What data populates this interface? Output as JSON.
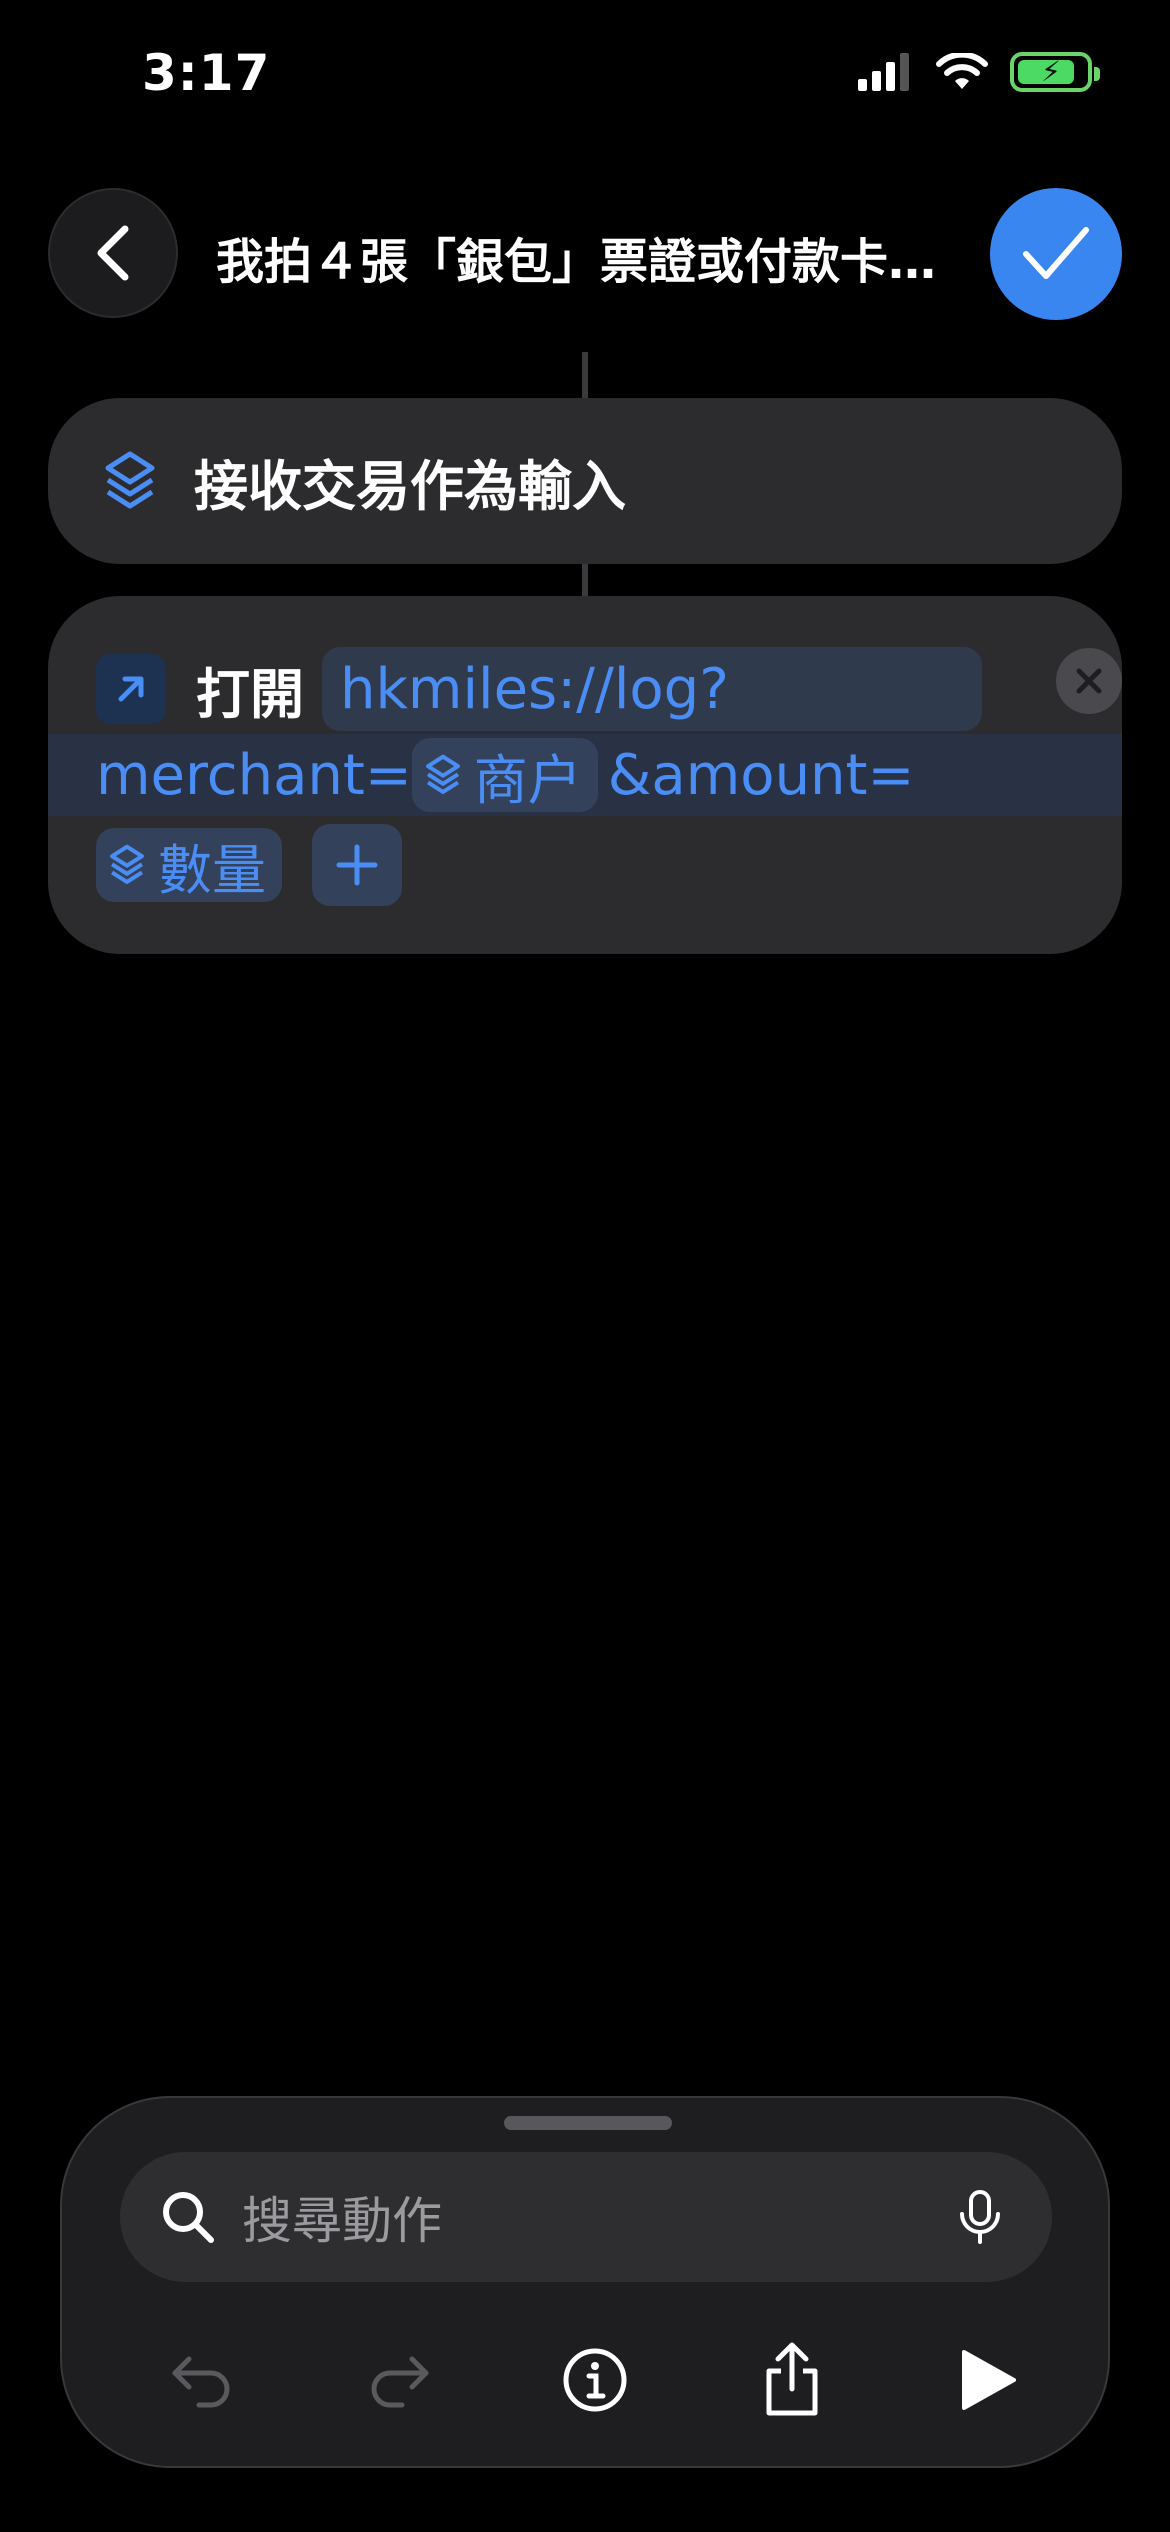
{
  "status_bar": {
    "time": "3:17",
    "icons": [
      "cellular-signal-icon",
      "wifi-icon",
      "battery-charging-icon"
    ]
  },
  "header": {
    "title": "我拍４張「銀包」票證或付款卡…",
    "back_icon": "chevron-left-icon",
    "done_icon": "checkmark-icon"
  },
  "actions": [
    {
      "icon": "wallet-stack-icon",
      "label": "接收交易作為輸入"
    },
    {
      "icon": "arrow-up-right-icon",
      "verb": "打開",
      "url_prefix": "hkmiles://log?",
      "param1_key": "merchant=",
      "param1_var": "商户",
      "param2_key": "&amount=",
      "param2_var": "數量",
      "clear_icon": "close-icon",
      "add_icon": "plus-icon"
    }
  ],
  "bottom_sheet": {
    "search_placeholder": "搜尋動作",
    "toolbar_icons": [
      "undo-icon",
      "redo-icon",
      "info-icon",
      "share-icon",
      "play-icon"
    ]
  },
  "colors": {
    "accent": "#3a86f0",
    "link_blue": "#4a8df5",
    "card_bg": "#2c2c2e",
    "background": "#000000"
  }
}
